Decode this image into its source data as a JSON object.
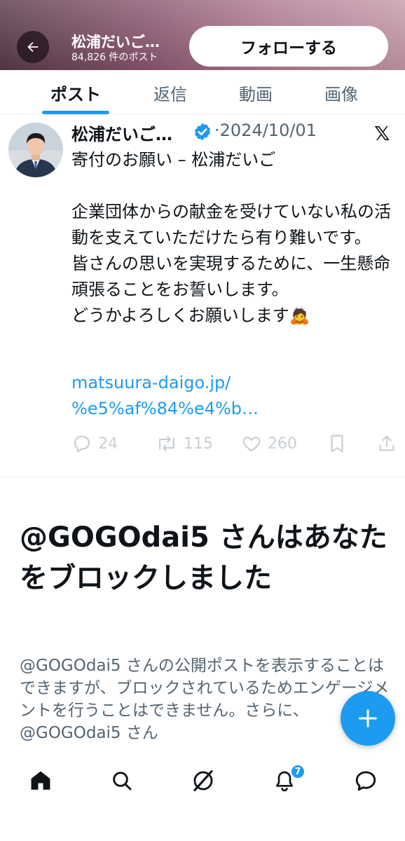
{
  "header": {
    "name": "松浦だいご…",
    "post_count": "84,826 件のポスト",
    "follow_label": "フォローする"
  },
  "tabs": [
    {
      "label": "ポスト",
      "active": true
    },
    {
      "label": "返信",
      "active": false
    },
    {
      "label": "動画",
      "active": false
    },
    {
      "label": "画像",
      "active": false
    }
  ],
  "post": {
    "author": "松浦だいご…",
    "date": "·2024/10/01",
    "body": "寄付のお願い – 松浦だいご\n\n企業団体からの献金を受けていない私の活動を支えていただけたら有り難いです。\n皆さんの思いを実現するために、一生懸命頑張ることをお誓いします。\nどうかよろしくお願いします🙇",
    "link": "matsuura-daigo.jp/\n%e5%af%84%e4%b…",
    "replies": "24",
    "reposts": "115",
    "likes": "260"
  },
  "blocked": {
    "title": "@GOGOdai5 さんはあなたをブロックしました",
    "description": "@GOGOdai5 さんの公開ポストを表示することはできますが、ブロックされているためエンゲージメントを行うことはできません。さらに、@GOGOdai5 さん"
  },
  "nav": {
    "notifications_badge": "7"
  },
  "colors": {
    "accent": "#1d9bf0",
    "text": "#0f1419",
    "muted": "#536471"
  },
  "icons": [
    "back-arrow-icon",
    "verified-badge-icon",
    "x-logo-icon",
    "reply-icon",
    "repost-icon",
    "like-icon",
    "bookmark-icon",
    "share-icon",
    "compose-plus-icon",
    "home-icon",
    "search-icon",
    "grok-icon",
    "notifications-icon",
    "messages-icon"
  ]
}
